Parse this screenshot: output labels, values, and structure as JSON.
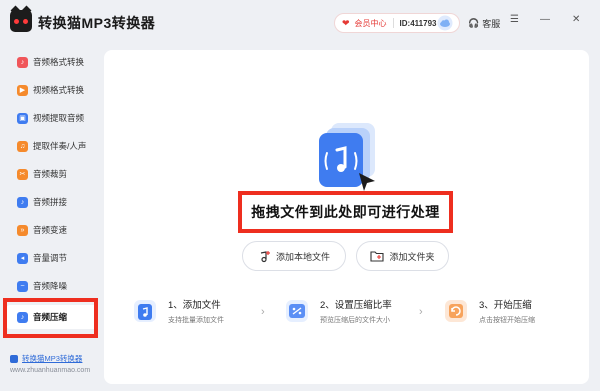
{
  "app": {
    "title": "转换猫MP3转换器"
  },
  "header": {
    "member_center": "会员中心",
    "user_id": "ID:411793",
    "service": "客服"
  },
  "sidebar": {
    "items": [
      {
        "label": "音频格式转换",
        "icon": "audio-convert-icon",
        "color": "#f0565a"
      },
      {
        "label": "视频格式转换",
        "icon": "video-convert-icon",
        "color": "#f58a2c"
      },
      {
        "label": "视频提取音频",
        "icon": "extract-audio-icon",
        "color": "#3f7cf0"
      },
      {
        "label": "提取伴奏/人声",
        "icon": "vocal-icon",
        "color": "#f58a2c"
      },
      {
        "label": "音频裁剪",
        "icon": "cut-icon",
        "color": "#f58a2c"
      },
      {
        "label": "音频拼接",
        "icon": "merge-icon",
        "color": "#3f7cf0"
      },
      {
        "label": "音频变速",
        "icon": "speed-icon",
        "color": "#f58a2c"
      },
      {
        "label": "音量调节",
        "icon": "volume-icon",
        "color": "#3f7cf0"
      },
      {
        "label": "音频降噪",
        "icon": "denoise-icon",
        "color": "#3f7cf0"
      },
      {
        "label": "音频压缩",
        "icon": "compress-icon",
        "color": "#3f7cf0",
        "active": true
      }
    ],
    "promo_link": "转换猫MP3转换器",
    "promo_url": "www.zhuanhuanmao.com"
  },
  "main": {
    "drop_text": "拖拽文件到此处即可进行处理",
    "add_file": "添加本地文件",
    "add_folder": "添加文件夹",
    "steps": [
      {
        "title": "1、添加文件",
        "desc": "支持批量添加文件"
      },
      {
        "title": "2、设置压缩比率",
        "desc": "预览压缩后的文件大小"
      },
      {
        "title": "3、开始压缩",
        "desc": "点击按钮开始压缩"
      }
    ]
  },
  "colors": {
    "accent": "#3f7cf0",
    "highlight": "#ee2e1f",
    "vip": "#e53935"
  }
}
